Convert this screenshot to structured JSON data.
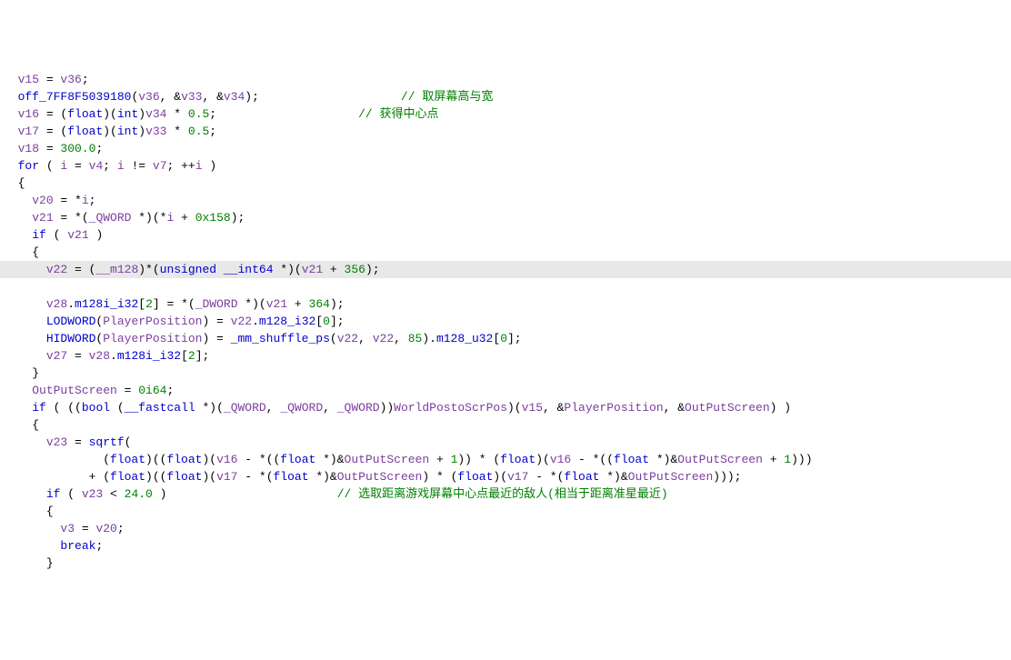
{
  "lines": [
    {
      "indent": "  ",
      "segments": [
        {
          "c": "var",
          "t": "v15"
        },
        {
          "c": "op",
          "t": " = "
        },
        {
          "c": "var",
          "t": "v36"
        },
        {
          "c": "op",
          "t": ";"
        }
      ]
    },
    {
      "indent": "  ",
      "segments": [
        {
          "c": "func",
          "t": "off_7FF8F5039180"
        },
        {
          "c": "op",
          "t": "("
        },
        {
          "c": "var",
          "t": "v36"
        },
        {
          "c": "op",
          "t": ", &"
        },
        {
          "c": "var",
          "t": "v33"
        },
        {
          "c": "op",
          "t": ", &"
        },
        {
          "c": "var",
          "t": "v34"
        },
        {
          "c": "op",
          "t": ");                    "
        },
        {
          "c": "cmt",
          "t": "// 取屏幕高与宽"
        }
      ]
    },
    {
      "indent": "  ",
      "segments": [
        {
          "c": "var",
          "t": "v16"
        },
        {
          "c": "op",
          "t": " = ("
        },
        {
          "c": "type",
          "t": "float"
        },
        {
          "c": "op",
          "t": ")("
        },
        {
          "c": "type",
          "t": "int"
        },
        {
          "c": "op",
          "t": ")"
        },
        {
          "c": "var",
          "t": "v34"
        },
        {
          "c": "op",
          "t": " * "
        },
        {
          "c": "num",
          "t": "0.5"
        },
        {
          "c": "op",
          "t": ";                    "
        },
        {
          "c": "cmt",
          "t": "// 获得中心点"
        }
      ]
    },
    {
      "indent": "  ",
      "segments": [
        {
          "c": "var",
          "t": "v17"
        },
        {
          "c": "op",
          "t": " = ("
        },
        {
          "c": "type",
          "t": "float"
        },
        {
          "c": "op",
          "t": ")("
        },
        {
          "c": "type",
          "t": "int"
        },
        {
          "c": "op",
          "t": ")"
        },
        {
          "c": "var",
          "t": "v33"
        },
        {
          "c": "op",
          "t": " * "
        },
        {
          "c": "num",
          "t": "0.5"
        },
        {
          "c": "op",
          "t": ";"
        }
      ]
    },
    {
      "indent": "  ",
      "segments": [
        {
          "c": "var",
          "t": "v18"
        },
        {
          "c": "op",
          "t": " = "
        },
        {
          "c": "num",
          "t": "300.0"
        },
        {
          "c": "op",
          "t": ";"
        }
      ]
    },
    {
      "indent": "  ",
      "segments": [
        {
          "c": "kw",
          "t": "for"
        },
        {
          "c": "op",
          "t": " ( "
        },
        {
          "c": "var",
          "t": "i"
        },
        {
          "c": "op",
          "t": " = "
        },
        {
          "c": "var",
          "t": "v4"
        },
        {
          "c": "op",
          "t": "; "
        },
        {
          "c": "var",
          "t": "i"
        },
        {
          "c": "op",
          "t": " != "
        },
        {
          "c": "var",
          "t": "v7"
        },
        {
          "c": "op",
          "t": "; ++"
        },
        {
          "c": "var",
          "t": "i"
        },
        {
          "c": "op",
          "t": " )"
        }
      ]
    },
    {
      "indent": "  ",
      "segments": [
        {
          "c": "op",
          "t": "{"
        }
      ]
    },
    {
      "indent": "    ",
      "segments": [
        {
          "c": "var",
          "t": "v20"
        },
        {
          "c": "op",
          "t": " = *"
        },
        {
          "c": "var",
          "t": "i"
        },
        {
          "c": "op",
          "t": ";"
        }
      ]
    },
    {
      "indent": "    ",
      "segments": [
        {
          "c": "var",
          "t": "v21"
        },
        {
          "c": "op",
          "t": " = *("
        },
        {
          "c": "type2",
          "t": "_QWORD"
        },
        {
          "c": "op",
          "t": " *)(*"
        },
        {
          "c": "var",
          "t": "i"
        },
        {
          "c": "op",
          "t": " + "
        },
        {
          "c": "num",
          "t": "0x158"
        },
        {
          "c": "op",
          "t": ");"
        }
      ]
    },
    {
      "indent": "    ",
      "segments": [
        {
          "c": "kw",
          "t": "if"
        },
        {
          "c": "op",
          "t": " ( "
        },
        {
          "c": "var",
          "t": "v21"
        },
        {
          "c": "op",
          "t": " )"
        }
      ]
    },
    {
      "indent": "    ",
      "segments": [
        {
          "c": "op",
          "t": "{"
        }
      ]
    },
    {
      "indent": "      ",
      "highlight": true,
      "segments": [
        {
          "c": "var",
          "t": "v22"
        },
        {
          "c": "op",
          "t": " = ("
        },
        {
          "c": "type2",
          "t": "__m128"
        },
        {
          "c": "op",
          "t": ")*("
        },
        {
          "c": "type",
          "t": "unsigned"
        },
        {
          "c": "op",
          "t": " "
        },
        {
          "c": "type",
          "t": "__int64"
        },
        {
          "c": "op",
          "t": " *)("
        },
        {
          "c": "var",
          "t": "v21"
        },
        {
          "c": "op",
          "t": " + "
        },
        {
          "c": "num",
          "t": "356"
        },
        {
          "c": "op",
          "t": ");"
        }
      ]
    },
    {
      "indent": "      ",
      "segments": [
        {
          "c": "var",
          "t": "v28"
        },
        {
          "c": "op",
          "t": "."
        },
        {
          "c": "field",
          "t": "m128i_i32"
        },
        {
          "c": "op",
          "t": "["
        },
        {
          "c": "num",
          "t": "2"
        },
        {
          "c": "op",
          "t": "] = *("
        },
        {
          "c": "type2",
          "t": "_DWORD"
        },
        {
          "c": "op",
          "t": " *)("
        },
        {
          "c": "var",
          "t": "v21"
        },
        {
          "c": "op",
          "t": " + "
        },
        {
          "c": "num",
          "t": "364"
        },
        {
          "c": "op",
          "t": ");"
        }
      ]
    },
    {
      "indent": "      ",
      "segments": [
        {
          "c": "func",
          "t": "LODWORD"
        },
        {
          "c": "op",
          "t": "("
        },
        {
          "c": "var",
          "t": "PlayerPosition"
        },
        {
          "c": "op",
          "t": ") = "
        },
        {
          "c": "var",
          "t": "v22"
        },
        {
          "c": "op",
          "t": "."
        },
        {
          "c": "field",
          "t": "m128_i32"
        },
        {
          "c": "op",
          "t": "["
        },
        {
          "c": "num",
          "t": "0"
        },
        {
          "c": "op",
          "t": "];"
        }
      ]
    },
    {
      "indent": "      ",
      "segments": [
        {
          "c": "func",
          "t": "HIDWORD"
        },
        {
          "c": "op",
          "t": "("
        },
        {
          "c": "var",
          "t": "PlayerPosition"
        },
        {
          "c": "op",
          "t": ") = "
        },
        {
          "c": "func",
          "t": "_mm_shuffle_ps"
        },
        {
          "c": "op",
          "t": "("
        },
        {
          "c": "var",
          "t": "v22"
        },
        {
          "c": "op",
          "t": ", "
        },
        {
          "c": "var",
          "t": "v22"
        },
        {
          "c": "op",
          "t": ", "
        },
        {
          "c": "num",
          "t": "85"
        },
        {
          "c": "op",
          "t": ")."
        },
        {
          "c": "field",
          "t": "m128_u32"
        },
        {
          "c": "op",
          "t": "["
        },
        {
          "c": "num",
          "t": "0"
        },
        {
          "c": "op",
          "t": "];"
        }
      ]
    },
    {
      "indent": "      ",
      "segments": [
        {
          "c": "var",
          "t": "v27"
        },
        {
          "c": "op",
          "t": " = "
        },
        {
          "c": "var",
          "t": "v28"
        },
        {
          "c": "op",
          "t": "."
        },
        {
          "c": "field",
          "t": "m128i_i32"
        },
        {
          "c": "op",
          "t": "["
        },
        {
          "c": "num",
          "t": "2"
        },
        {
          "c": "op",
          "t": "];"
        }
      ]
    },
    {
      "indent": "    ",
      "segments": [
        {
          "c": "op",
          "t": "}"
        }
      ]
    },
    {
      "indent": "    ",
      "segments": [
        {
          "c": "var",
          "t": "OutPutScreen"
        },
        {
          "c": "op",
          "t": " = "
        },
        {
          "c": "num",
          "t": "0i64"
        },
        {
          "c": "op",
          "t": ";"
        }
      ]
    },
    {
      "indent": "    ",
      "segments": [
        {
          "c": "kw",
          "t": "if"
        },
        {
          "c": "op",
          "t": " ( (("
        },
        {
          "c": "type",
          "t": "bool"
        },
        {
          "c": "op",
          "t": " ("
        },
        {
          "c": "type",
          "t": "__fastcall"
        },
        {
          "c": "op",
          "t": " *)("
        },
        {
          "c": "type2",
          "t": "_QWORD"
        },
        {
          "c": "op",
          "t": ", "
        },
        {
          "c": "type2",
          "t": "_QWORD"
        },
        {
          "c": "op",
          "t": ", "
        },
        {
          "c": "type2",
          "t": "_QWORD"
        },
        {
          "c": "op",
          "t": "))"
        },
        {
          "c": "var",
          "t": "WorldPostoScrPos"
        },
        {
          "c": "op",
          "t": ")("
        },
        {
          "c": "var",
          "t": "v15"
        },
        {
          "c": "op",
          "t": ", &"
        },
        {
          "c": "var",
          "t": "PlayerPosition"
        },
        {
          "c": "op",
          "t": ", &"
        },
        {
          "c": "var",
          "t": "OutPutScreen"
        },
        {
          "c": "op",
          "t": ") )"
        }
      ]
    },
    {
      "indent": "    ",
      "segments": [
        {
          "c": "op",
          "t": "{"
        }
      ]
    },
    {
      "indent": "      ",
      "segments": [
        {
          "c": "var",
          "t": "v23"
        },
        {
          "c": "op",
          "t": " = "
        },
        {
          "c": "func",
          "t": "sqrtf"
        },
        {
          "c": "op",
          "t": "("
        }
      ]
    },
    {
      "indent": "              ",
      "segments": [
        {
          "c": "op",
          "t": "("
        },
        {
          "c": "type",
          "t": "float"
        },
        {
          "c": "op",
          "t": ")(("
        },
        {
          "c": "type",
          "t": "float"
        },
        {
          "c": "op",
          "t": ")("
        },
        {
          "c": "var",
          "t": "v16"
        },
        {
          "c": "op",
          "t": " - *(("
        },
        {
          "c": "type",
          "t": "float"
        },
        {
          "c": "op",
          "t": " *)&"
        },
        {
          "c": "var",
          "t": "OutPutScreen"
        },
        {
          "c": "op",
          "t": " + "
        },
        {
          "c": "num",
          "t": "1"
        },
        {
          "c": "op",
          "t": ")) * ("
        },
        {
          "c": "type",
          "t": "float"
        },
        {
          "c": "op",
          "t": ")("
        },
        {
          "c": "var",
          "t": "v16"
        },
        {
          "c": "op",
          "t": " - *(("
        },
        {
          "c": "type",
          "t": "float"
        },
        {
          "c": "op",
          "t": " *)&"
        },
        {
          "c": "var",
          "t": "OutPutScreen"
        },
        {
          "c": "op",
          "t": " + "
        },
        {
          "c": "num",
          "t": "1"
        },
        {
          "c": "op",
          "t": ")))"
        }
      ]
    },
    {
      "indent": "            ",
      "segments": [
        {
          "c": "op",
          "t": "+ ("
        },
        {
          "c": "type",
          "t": "float"
        },
        {
          "c": "op",
          "t": ")(("
        },
        {
          "c": "type",
          "t": "float"
        },
        {
          "c": "op",
          "t": ")("
        },
        {
          "c": "var",
          "t": "v17"
        },
        {
          "c": "op",
          "t": " - *("
        },
        {
          "c": "type",
          "t": "float"
        },
        {
          "c": "op",
          "t": " *)&"
        },
        {
          "c": "var",
          "t": "OutPutScreen"
        },
        {
          "c": "op",
          "t": ") * ("
        },
        {
          "c": "type",
          "t": "float"
        },
        {
          "c": "op",
          "t": ")("
        },
        {
          "c": "var",
          "t": "v17"
        },
        {
          "c": "op",
          "t": " - *("
        },
        {
          "c": "type",
          "t": "float"
        },
        {
          "c": "op",
          "t": " *)&"
        },
        {
          "c": "var",
          "t": "OutPutScreen"
        },
        {
          "c": "op",
          "t": ")));"
        }
      ]
    },
    {
      "indent": "      ",
      "segments": [
        {
          "c": "kw",
          "t": "if"
        },
        {
          "c": "op",
          "t": " ( "
        },
        {
          "c": "var",
          "t": "v23"
        },
        {
          "c": "op",
          "t": " < "
        },
        {
          "c": "num",
          "t": "24.0"
        },
        {
          "c": "op",
          "t": " )                        "
        },
        {
          "c": "cmt",
          "t": "// 选取距离游戏屏幕中心点最近的敌人(相当于距离准星最近)"
        }
      ]
    },
    {
      "indent": "      ",
      "segments": [
        {
          "c": "op",
          "t": "{"
        }
      ]
    },
    {
      "indent": "        ",
      "segments": [
        {
          "c": "var",
          "t": "v3"
        },
        {
          "c": "op",
          "t": " = "
        },
        {
          "c": "var",
          "t": "v20"
        },
        {
          "c": "op",
          "t": ";"
        }
      ]
    },
    {
      "indent": "        ",
      "segments": [
        {
          "c": "kw",
          "t": "break"
        },
        {
          "c": "op",
          "t": ";"
        }
      ]
    },
    {
      "indent": "      ",
      "segments": [
        {
          "c": "op",
          "t": "}"
        }
      ]
    }
  ]
}
